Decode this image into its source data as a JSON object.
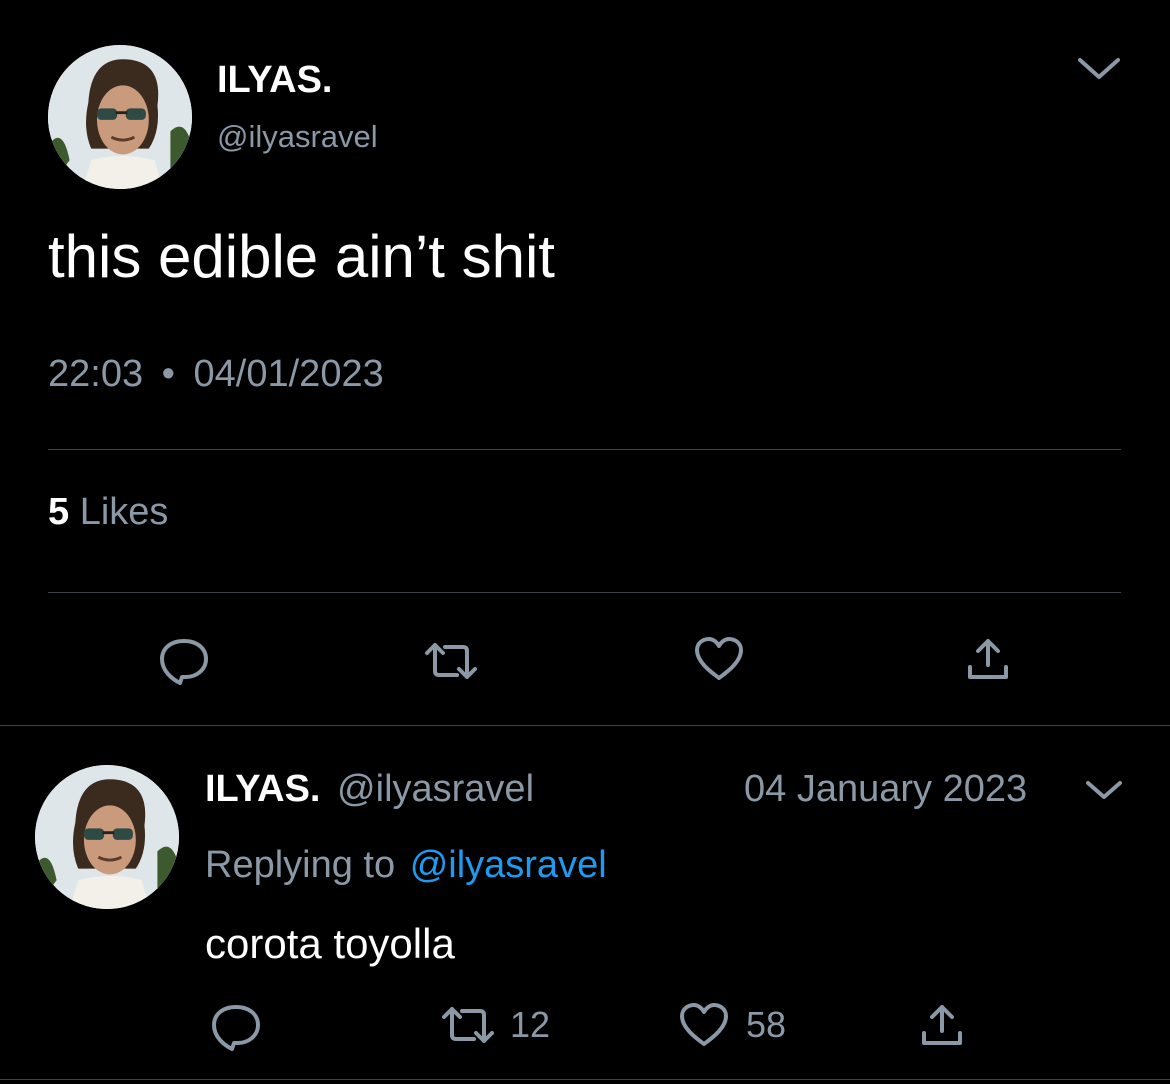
{
  "main_tweet": {
    "display_name": "ILYAS.",
    "handle": "@ilyasravel",
    "text": "this edible ain’t shit",
    "time": "22:03",
    "separator": "•",
    "date": "04/01/2023",
    "likes_count": "5",
    "likes_label": "Likes",
    "icons": [
      "reply-icon",
      "retweet-icon",
      "like-icon",
      "share-icon",
      "chevron-down-icon"
    ]
  },
  "reply_tweet": {
    "display_name": "ILYAS.",
    "handle": "@ilyasravel",
    "date": "04 January 2023",
    "replying_to_label": "Replying to",
    "replying_to_handle": "@ilyasravel",
    "text": "corota toyolla",
    "retweet_count": "12",
    "like_count": "58",
    "icons": [
      "reply-icon",
      "retweet-icon",
      "like-icon",
      "share-icon",
      "chevron-down-icon"
    ]
  },
  "colors": {
    "background": "#000000",
    "text": "#e7e9ea",
    "muted": "#8b98a5",
    "link": "#1d9bf0",
    "divider": "#38444d"
  }
}
